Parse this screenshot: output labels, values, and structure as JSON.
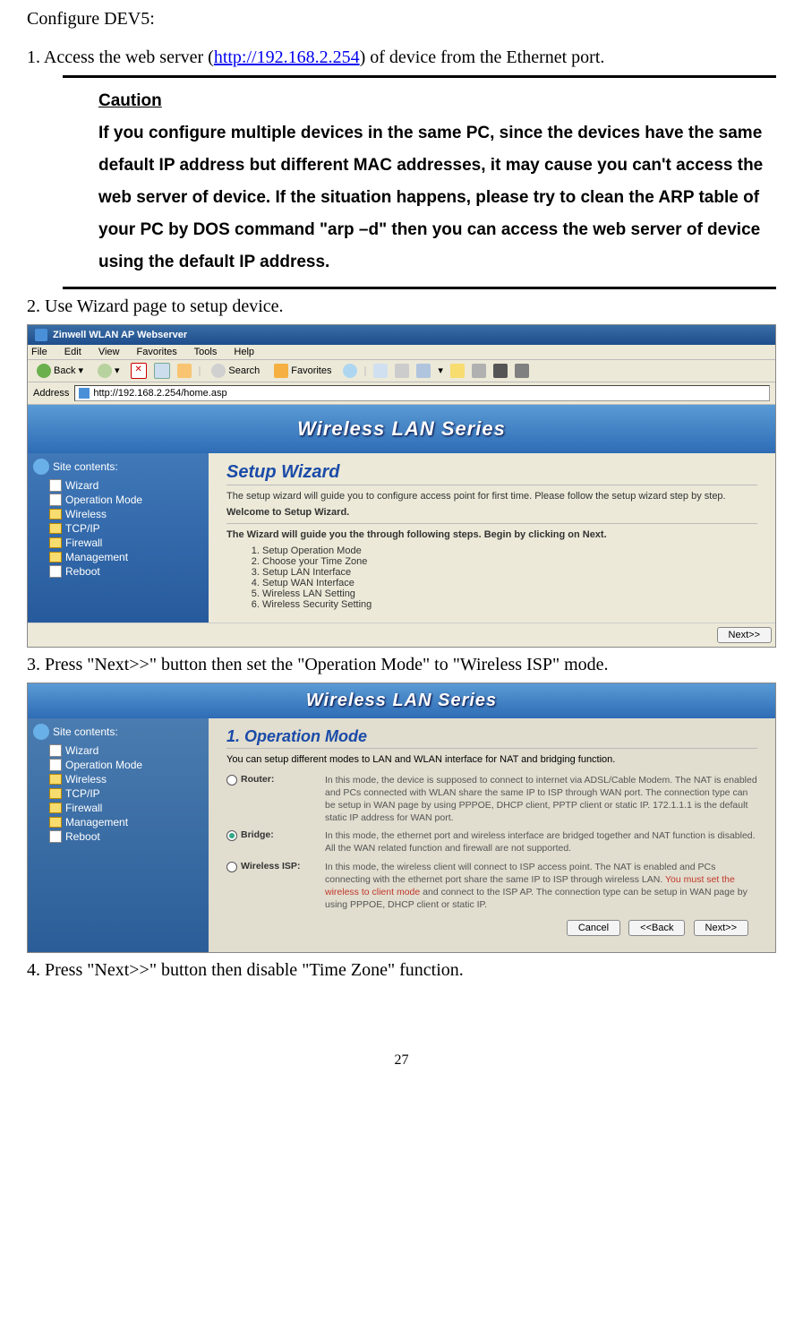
{
  "header": "Configure DEV5:",
  "step1_pre": "1. Access the web server (",
  "step1_link": "http://192.168.2.254",
  "step1_post": ") of device from the Ethernet port.",
  "caution_label": "Caution",
  "caution_text": "If you configure multiple devices in the same PC, since the devices have the same default IP address but different MAC addresses, it may cause you can't access the web server of device. If the situation happens, please try to clean the ARP table of your PC by DOS command \"arp –d\" then you can access the web server of device using the default IP address.",
  "step2": "2. Use Wizard page to setup device.",
  "step3": "3. Press \"Next>>\" button then set the \"Operation Mode\" to \"Wireless ISP\" mode.",
  "step4": "4. Press \"Next>>\" button then disable \"Time Zone\" function.",
  "ie": {
    "title": "Zinwell WLAN AP Webserver",
    "menu": {
      "file": "File",
      "edit": "Edit",
      "view": "View",
      "favorites": "Favorites",
      "tools": "Tools",
      "help": "Help"
    },
    "back": "Back",
    "search": "Search",
    "favlabel": "Favorites",
    "address_lbl": "Address",
    "url": "http://192.168.2.254/home.asp"
  },
  "banner": "Wireless LAN Series",
  "sidebar": {
    "header": "Site contents:",
    "items": [
      {
        "label": "Wizard",
        "type": "doc"
      },
      {
        "label": "Operation Mode",
        "type": "doc"
      },
      {
        "label": "Wireless",
        "type": "fld"
      },
      {
        "label": "TCP/IP",
        "type": "fld"
      },
      {
        "label": "Firewall",
        "type": "fld"
      },
      {
        "label": "Management",
        "type": "fld"
      },
      {
        "label": "Reboot",
        "type": "doc"
      }
    ]
  },
  "wizard": {
    "title": "Setup Wizard",
    "intro": "The setup wizard will guide you to configure access point for first time. Please follow the setup wizard step by step.",
    "welcome": "Welcome to Setup Wizard.",
    "guide": "The Wizard will guide you the through following steps. Begin by clicking on Next.",
    "steps": [
      "Setup Operation Mode",
      "Choose your Time Zone",
      "Setup LAN Interface",
      "Setup WAN Interface",
      "Wireless LAN Setting",
      "Wireless Security Setting"
    ],
    "next_btn": "Next>>"
  },
  "opmode": {
    "title": "1. Operation Mode",
    "desc": "You can setup different modes to LAN and WLAN interface for NAT and bridging function.",
    "router_label": "Router:",
    "router_text": "In this mode, the device is supposed to connect to internet via ADSL/Cable Modem. The NAT is enabled and PCs connected with WLAN share the same IP to ISP through WAN port. The connection type can be setup in WAN page by using PPPOE, DHCP client, PPTP client or static IP. 172.1.1.1 is the default static IP address for WAN port.",
    "bridge_label": "Bridge:",
    "bridge_text": "In this mode, the ethernet port and wireless interface are bridged together and NAT function is disabled. All the WAN related function and firewall are not supported.",
    "wisp_label": "Wireless ISP:",
    "wisp_text1": "In this mode, the wireless client will connect to ISP access point. The NAT is enabled and PCs connecting with the ethernet port share the same IP to ISP through wireless LAN. ",
    "wisp_red": "You must set the wireless to client mode",
    "wisp_text2": " and connect to the ISP AP. The connection type can be setup in WAN page by using PPPOE, DHCP client or static IP.",
    "cancel": "Cancel",
    "back": "<<Back",
    "next": "Next>>"
  },
  "page_number": "27"
}
